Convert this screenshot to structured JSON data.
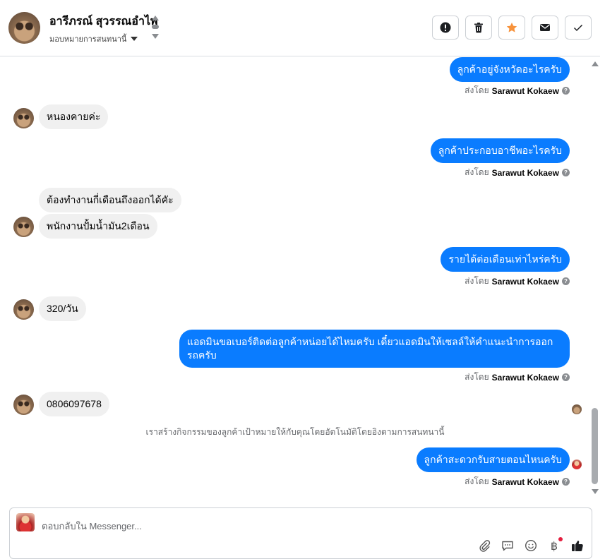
{
  "header": {
    "contact_name": "อารีภรณ์ สุวรรณอำไพ",
    "assign_label": "มอบหมายการสนทนานี้",
    "actions": [
      {
        "name": "mark-spam-button",
        "icon": "exclamation-icon"
      },
      {
        "name": "delete-button",
        "icon": "trash-icon"
      },
      {
        "name": "star-button",
        "icon": "star-icon"
      },
      {
        "name": "mark-unread-button",
        "icon": "envelope-icon"
      },
      {
        "name": "mark-done-button",
        "icon": "check-icon"
      }
    ]
  },
  "sent_by": {
    "prefix": "ส่งโดย",
    "agent": "Sarawut Kokaew",
    "help_glyph": "?"
  },
  "messages": [
    {
      "dir": "out",
      "text": "ลูกค้าอยู่จังหวัดอะไรครับ"
    },
    {
      "dir": "in",
      "text": "หนองคายค่ะ"
    },
    {
      "dir": "out",
      "text": "ลูกค้าประกอบอาชีพอะไรครับ"
    },
    {
      "dir": "in",
      "text": "ต้องทำงานกี่เดือนถึงออกได้คัะ"
    },
    {
      "dir": "in",
      "text": "พนักงานปั้มน้ำมัน2เดือน"
    },
    {
      "dir": "out",
      "text": "รายได้ต่อเดือนเท่าไหร่ครับ"
    },
    {
      "dir": "in",
      "text": "320/วัน"
    },
    {
      "dir": "out",
      "text": "แอดมินขอเบอร์ติดต่อลูกค้าหน่อยได้ไหมครับ เดี๋ยวแอดมินให้เซลล์ให้คำแนะนำการออกรถครับ"
    },
    {
      "dir": "in",
      "text": "0806097678"
    },
    {
      "dir": "system",
      "text": "เราสร้างกิจกรรมของลูกค้าเป้าหมายให้กับคุณโดยอัตโนมัติโดยอิงตามการสนทนานี้"
    },
    {
      "dir": "out",
      "text": "ลูกค้าสะดวกรับสายตอนไหนครับ"
    }
  ],
  "composer": {
    "placeholder": "ตอบกลับใน Messenger...",
    "tools": [
      "paperclip-icon",
      "saved-reply-icon",
      "emoji-icon",
      "baht-icon",
      "thumbs-up-icon"
    ],
    "baht_glyph": "฿"
  },
  "colors": {
    "outgoing_bubble": "#0a7cff",
    "incoming_bubble": "#f0f0f0",
    "star": "#f7923b",
    "like": "#1c1e21"
  }
}
